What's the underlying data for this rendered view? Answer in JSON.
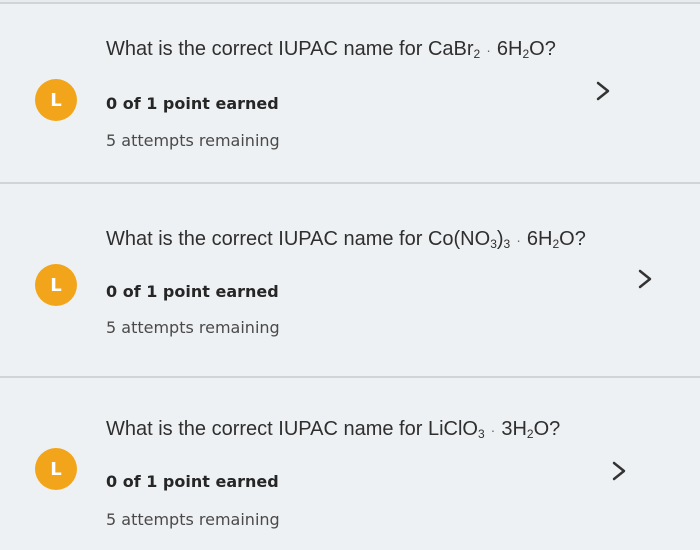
{
  "questions": [
    {
      "prefix": "What is the correct IUPAC name for ",
      "formula": [
        "CaBr",
        "2",
        "",
        "",
        ""
      ],
      "hydrate": [
        "6H",
        "2",
        "O?"
      ],
      "points": "0 of 1 point earned",
      "attempts": "5 attempts remaining",
      "badge_glyph": "L",
      "dot": "·"
    },
    {
      "prefix": "What is the correct IUPAC name for ",
      "formula": [
        "Co(NO",
        "3",
        ")",
        "3",
        ""
      ],
      "hydrate": [
        "6H",
        "2",
        "O?"
      ],
      "points": "0 of 1 point earned",
      "attempts": "5 attempts remaining",
      "badge_glyph": "L",
      "dot": "·"
    },
    {
      "prefix": "What is the correct IUPAC name for ",
      "formula": [
        "LiClO",
        "3",
        "",
        "",
        ""
      ],
      "hydrate": [
        "3H",
        "2",
        "O?"
      ],
      "points": "0 of 1 point earned",
      "attempts": "5 attempts remaining",
      "badge_glyph": "L",
      "dot": "·"
    }
  ],
  "colors": {
    "badge": "#f2a51a",
    "background": "#eef1f3",
    "divider": "#d0d4d8"
  },
  "icons": {
    "status": "user-progress-icon",
    "open": "chevron-right-icon"
  }
}
